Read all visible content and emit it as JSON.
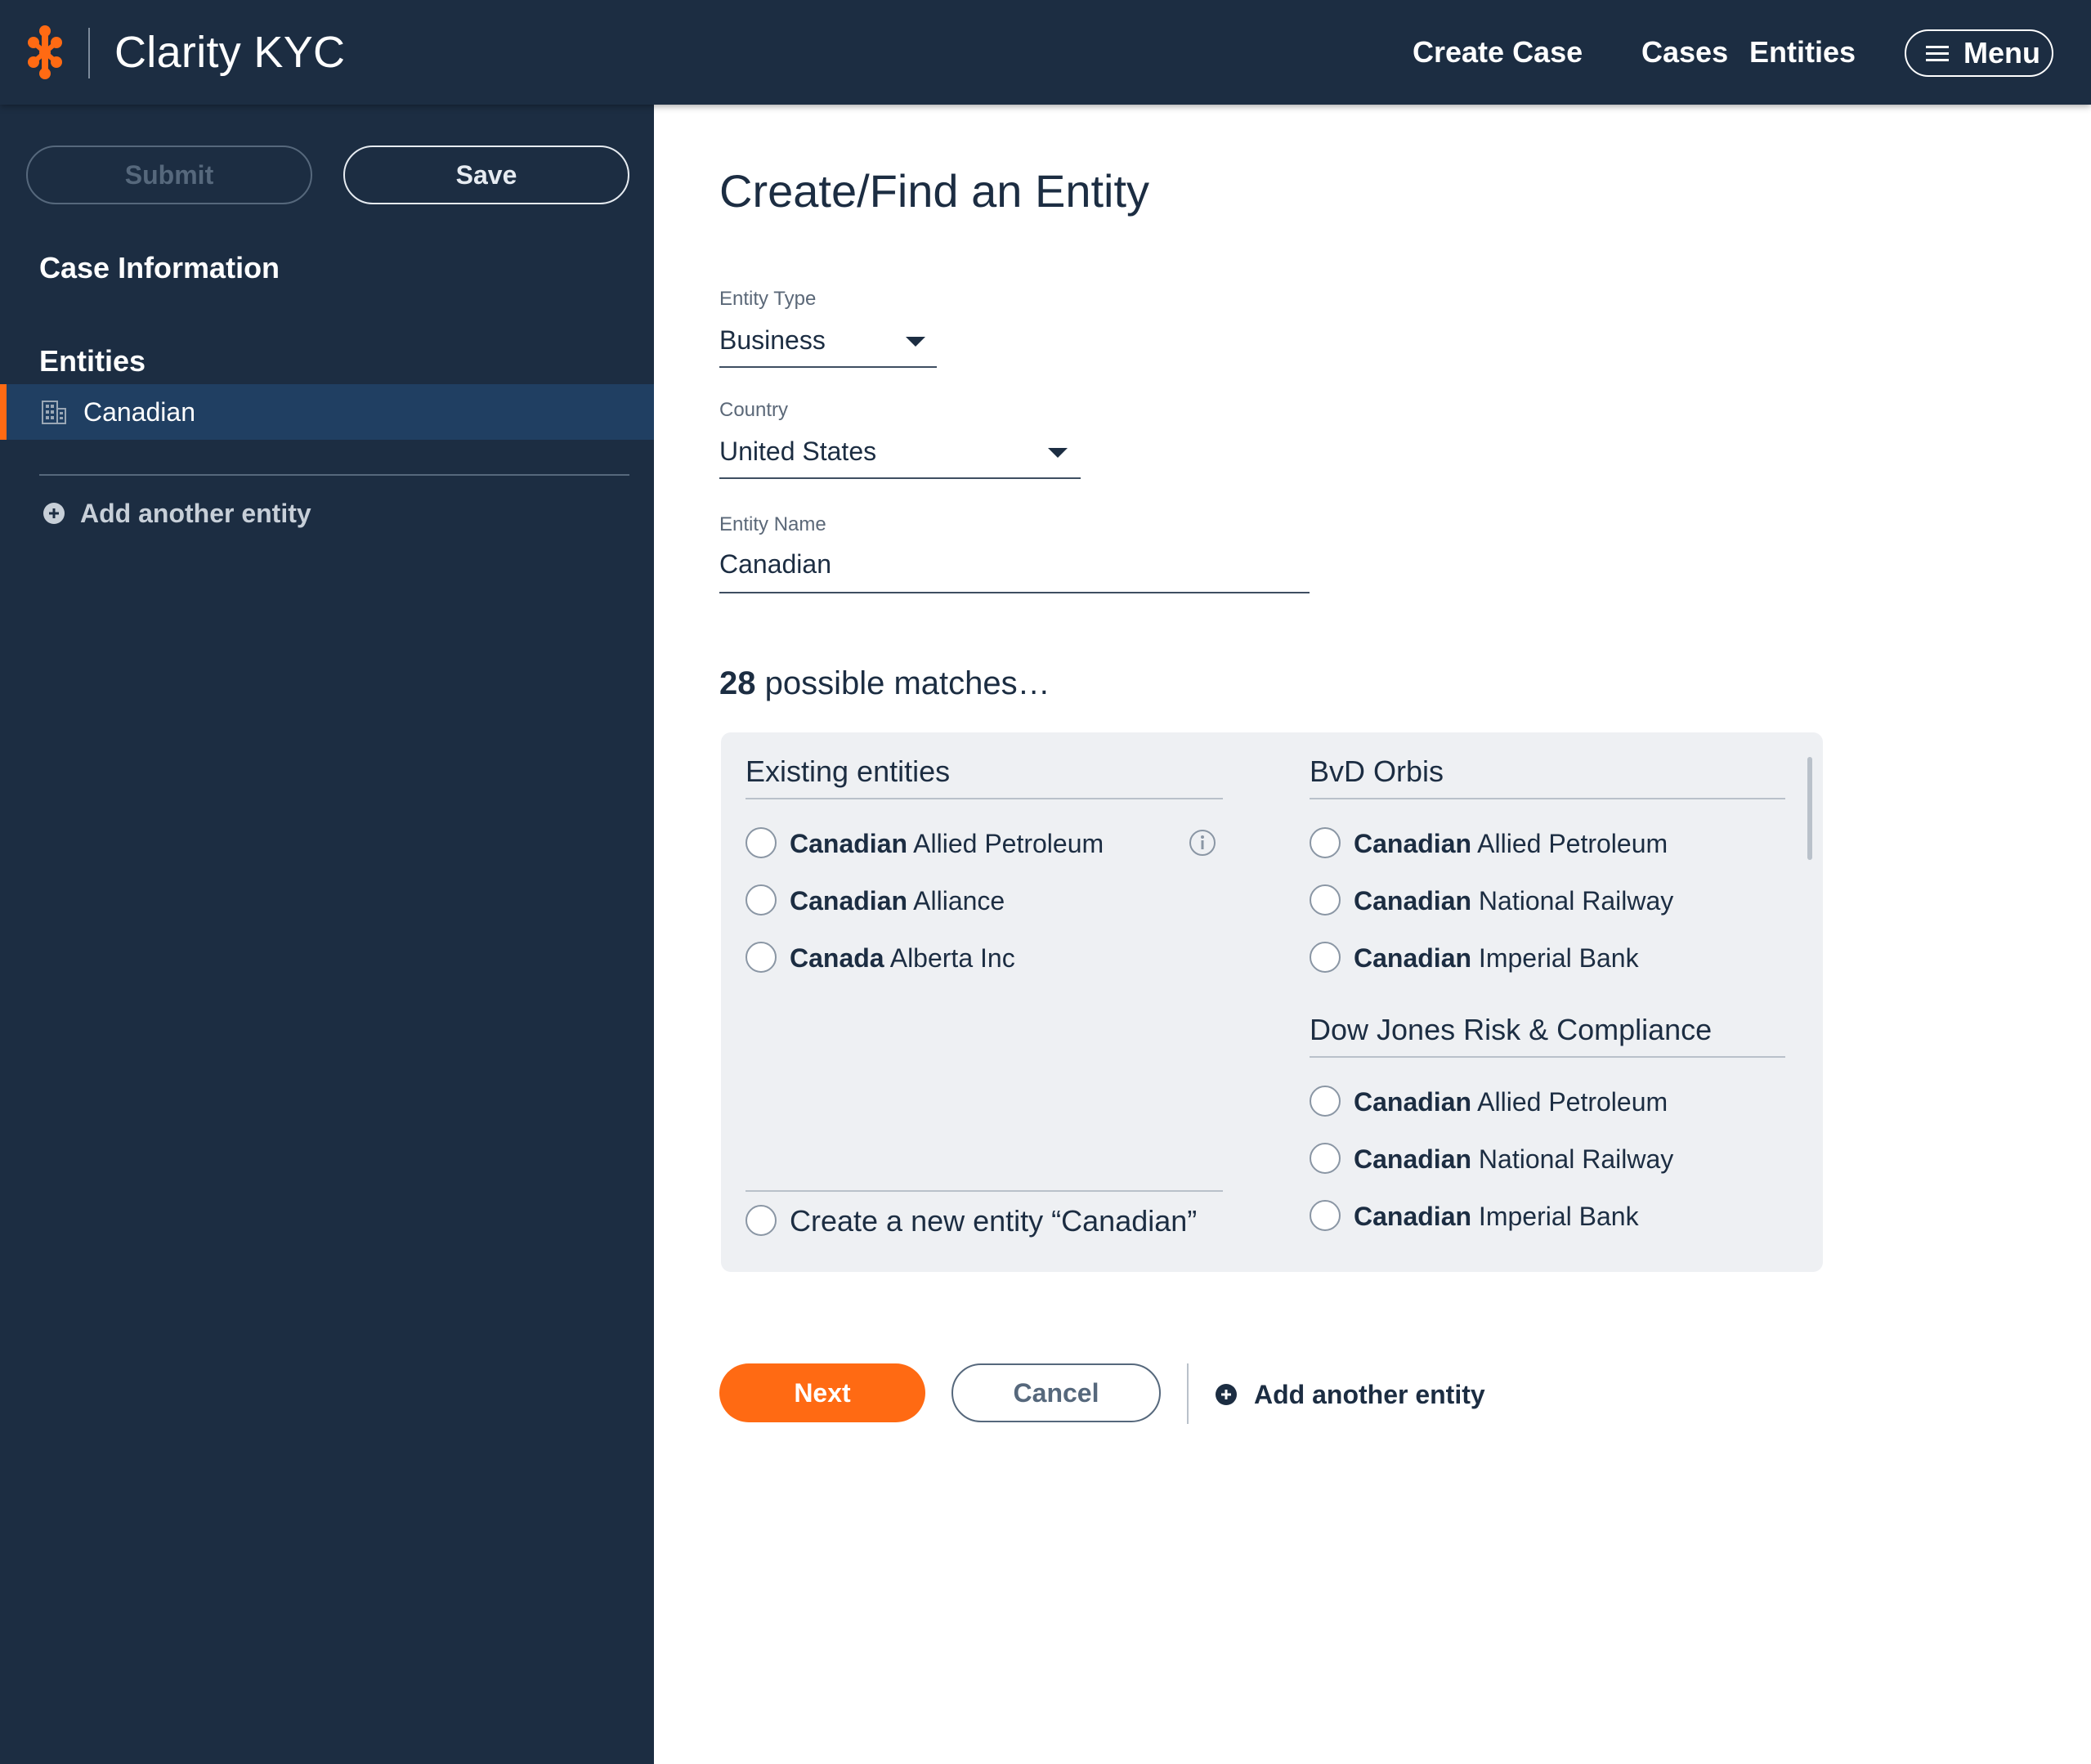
{
  "app": {
    "title": "Clarity KYC",
    "logo_icon": "clarity-logo-icon",
    "brand_color": "#ff6a13",
    "nav_color": "#1c2d42"
  },
  "nav": {
    "links": [
      "Create Case",
      "Cases",
      "Entities"
    ],
    "menu_label": "Menu",
    "menu_icon": "hamburger-icon"
  },
  "sidebar": {
    "submit_label": "Submit",
    "save_label": "Save",
    "case_info_heading": "Case Information",
    "entities_heading": "Entities",
    "entities": [
      {
        "label": "Canadian",
        "icon": "building-icon",
        "active": true
      }
    ],
    "add_entity_label": "Add another entity",
    "add_entity_icon": "plus-circle-icon"
  },
  "form": {
    "title": "Create/Find an Entity",
    "entity_type": {
      "label": "Entity Type",
      "value": "Business"
    },
    "country": {
      "label": "Country",
      "value": "United States"
    },
    "entity_name": {
      "label": "Entity Name",
      "value": "Canadian"
    }
  },
  "matches": {
    "count": "28",
    "suffix": " possible matches…",
    "existing": {
      "heading": "Existing entities",
      "items": [
        {
          "bold": "Canadian",
          "rest": " Allied Petroleum",
          "has_info": true
        },
        {
          "bold": "Canadian",
          "rest": " Alliance",
          "has_info": false
        },
        {
          "bold": "Canada",
          "rest": " Alberta Inc",
          "has_info": false
        }
      ],
      "create_new_label": "Create a new entity “Canadian”"
    },
    "bvd": {
      "heading": "BvD Orbis",
      "items": [
        {
          "bold": "Canadian",
          "rest": " Allied Petroleum"
        },
        {
          "bold": "Canadian",
          "rest": " National Railway"
        },
        {
          "bold": "Canadian",
          "rest": " Imperial Bank"
        }
      ]
    },
    "dowjones": {
      "heading": "Dow Jones Risk & Compliance",
      "items": [
        {
          "bold": "Canadian",
          "rest": " Allied Petroleum"
        },
        {
          "bold": "Canadian",
          "rest": " National Railway"
        },
        {
          "bold": "Canadian",
          "rest": " Imperial Bank"
        }
      ]
    }
  },
  "actions": {
    "next_label": "Next",
    "cancel_label": "Cancel",
    "add_entity_label": "Add another entity"
  }
}
